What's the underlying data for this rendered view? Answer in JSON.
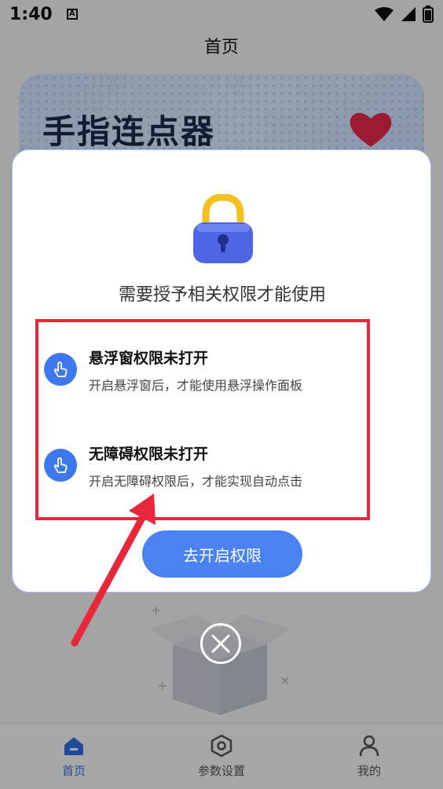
{
  "status_bar": {
    "time": "1:40",
    "notification_badge": "A"
  },
  "header": {
    "title": "首页"
  },
  "banner": {
    "title": "手指连点器"
  },
  "dialog": {
    "title": "需要授予相关权限才能使用",
    "permissions": [
      {
        "title": "悬浮窗权限未打开",
        "desc": "开启悬浮窗后，才能使用悬浮操作面板",
        "icon": "touch-icon"
      },
      {
        "title": "无障碍权限未打开",
        "desc": "开启无障碍权限后，才能实现自动点击",
        "icon": "touch-icon"
      }
    ],
    "button_label": "去开启权限"
  },
  "bottom_nav": {
    "items": [
      {
        "label": "首页",
        "icon": "home-icon",
        "active": true
      },
      {
        "label": "参数设置",
        "icon": "settings-hexagon-icon",
        "active": false
      },
      {
        "label": "我的",
        "icon": "user-icon",
        "active": false
      }
    ]
  },
  "colors": {
    "accent": "#4a82f3",
    "highlight": "#e8283a",
    "overlay": "rgba(0,0,0,0.32)"
  }
}
